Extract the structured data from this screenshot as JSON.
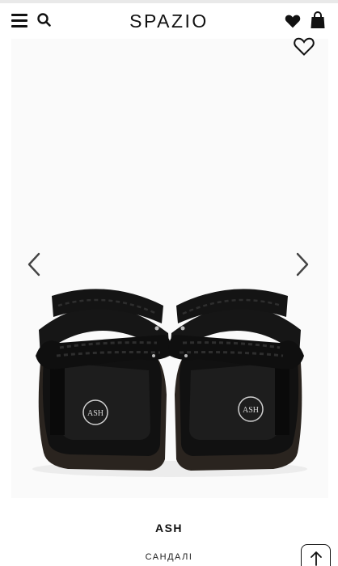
{
  "header": {
    "logo": "SPAZIO",
    "icons": [
      "menu-icon",
      "search-icon",
      "heart-icon",
      "bag-icon"
    ]
  },
  "gallery": {
    "icons": [
      "favorite-heart-icon",
      "chevron-left-icon",
      "chevron-right-icon"
    ],
    "image": "black woven strap sandals, rear view",
    "sole_logo": "ASH"
  },
  "product": {
    "brand": "ASH",
    "category": "САНДАЛІ"
  },
  "colors": {
    "text": "#111111",
    "background": "#ffffff",
    "gallery_bg": "#fafafa"
  }
}
